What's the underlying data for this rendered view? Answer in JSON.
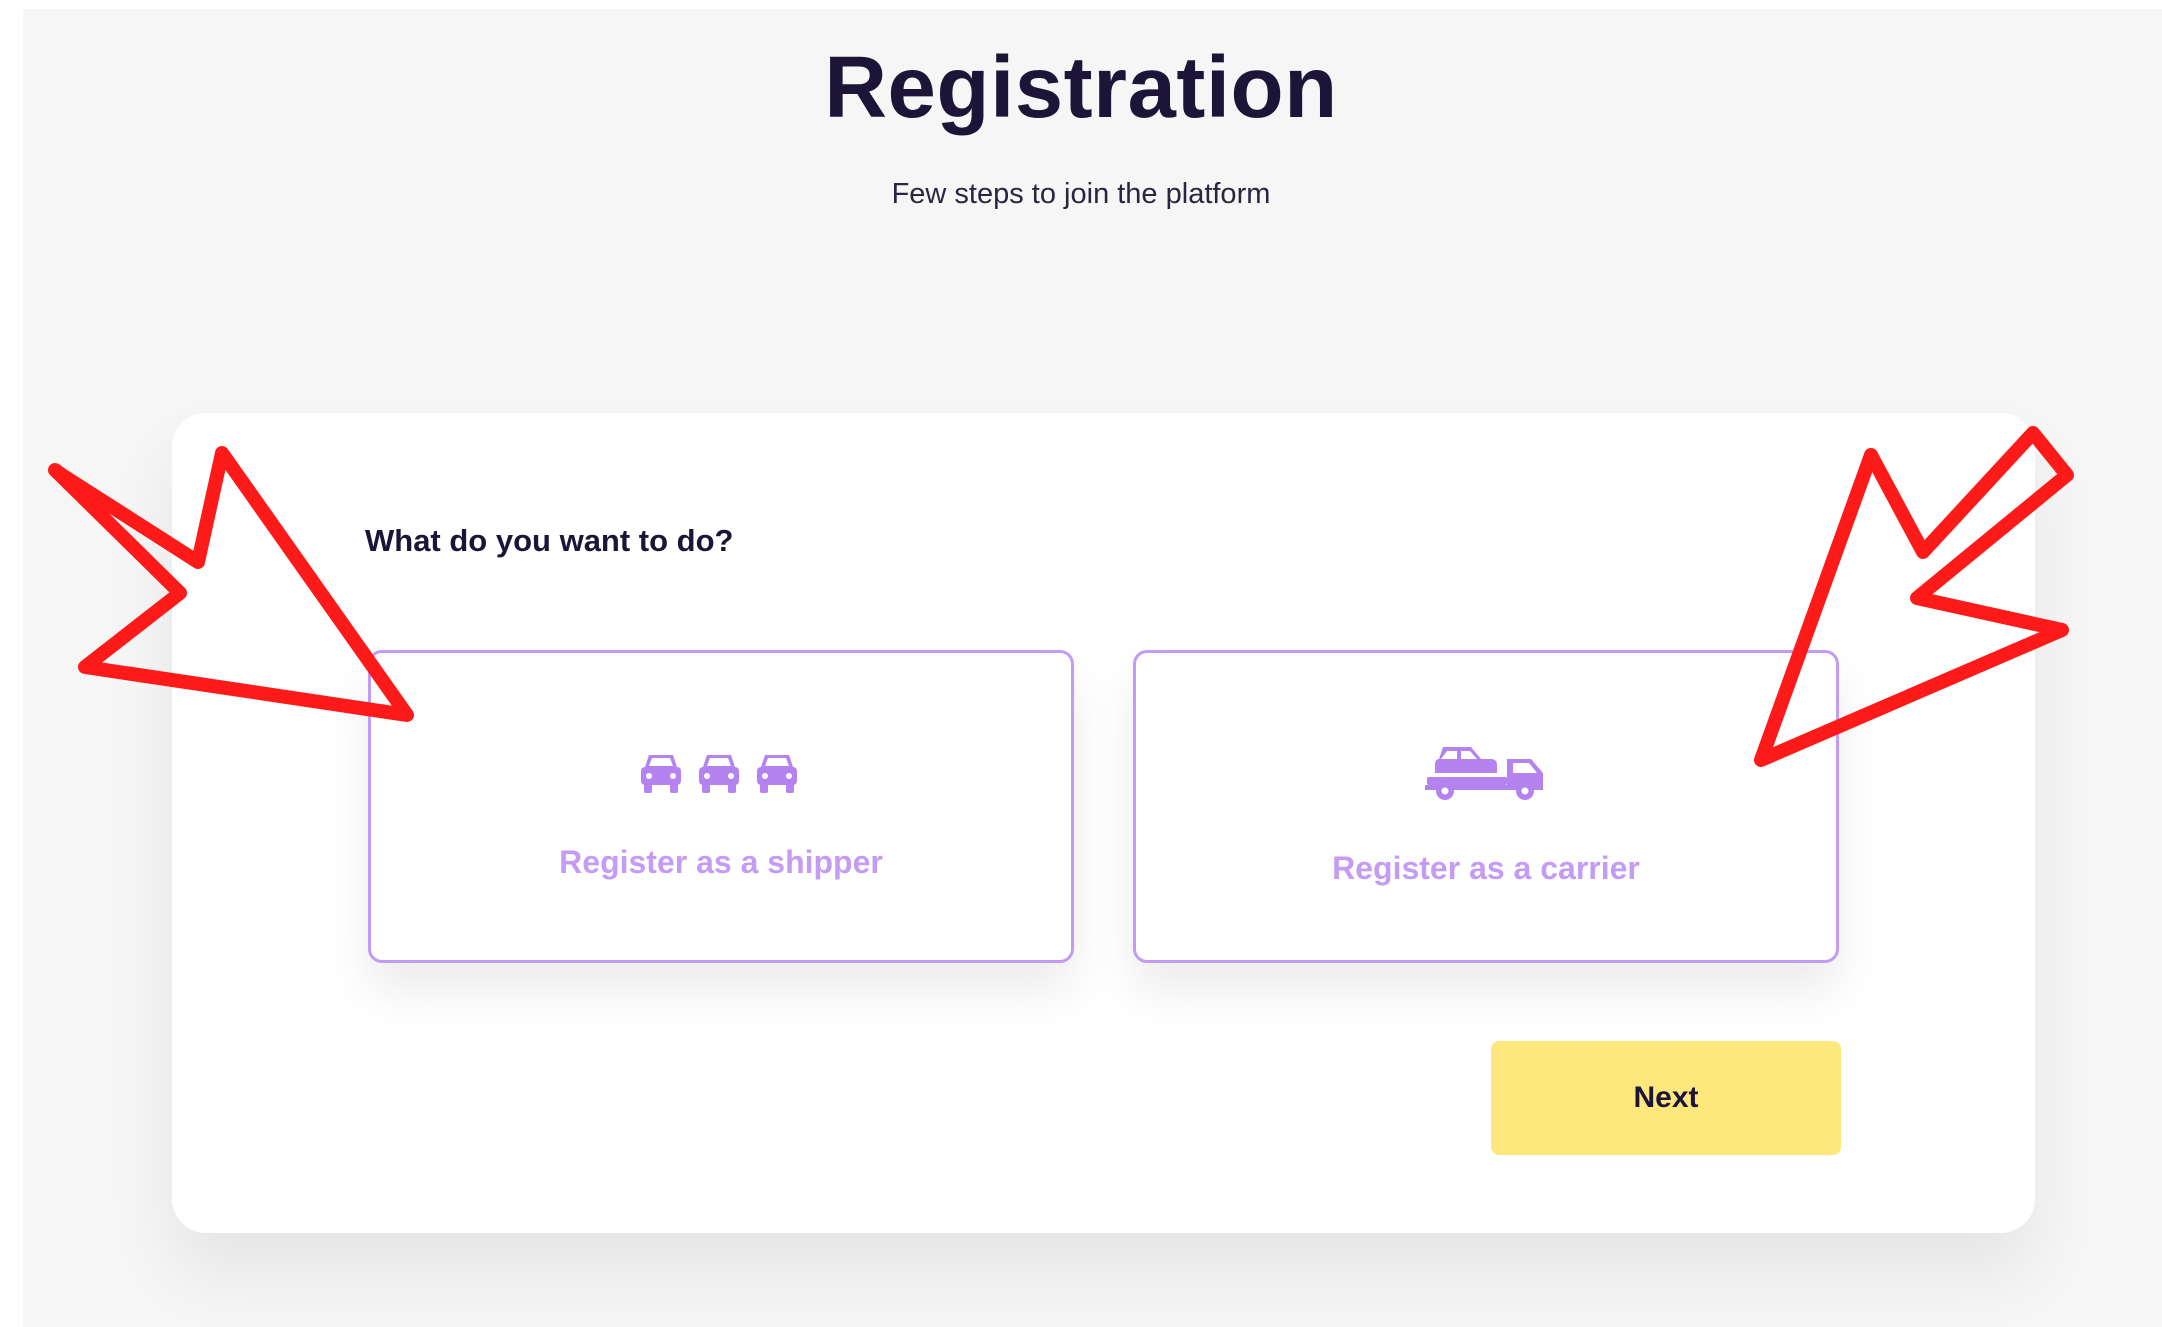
{
  "header": {
    "title": "Registration",
    "subtitle": "Few steps to join the platform"
  },
  "form": {
    "question": "What do you want to do?",
    "options": [
      {
        "label": "Register as a shipper",
        "icon": "three-cars-icon"
      },
      {
        "label": "Register as a carrier",
        "icon": "car-transporter-truck-icon"
      }
    ],
    "next_label": "Next"
  },
  "colors": {
    "background": "#f6f6f6",
    "card": "#ffffff",
    "title_text": "#1c1537",
    "option_accent": "#c49bf5",
    "option_border": "#c19cf7",
    "next_button": "#fee87d",
    "annotation_arrows": "#ff1a1a"
  }
}
